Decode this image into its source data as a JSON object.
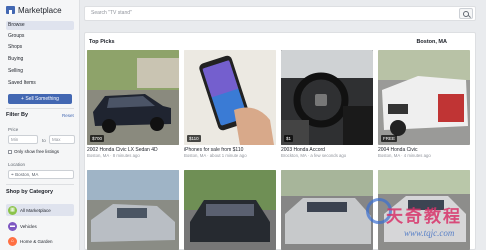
{
  "sidebar": {
    "brand_title": "Marketplace",
    "nav": [
      "Browse",
      "Groups",
      "Shops",
      "Buying",
      "Selling",
      "Saved Items"
    ],
    "sell_button": "+ Sell Something",
    "filter_heading": "Filter By",
    "reset_link": "Reset",
    "price_label": "Price",
    "price_min_placeholder": "Min",
    "price_to": "to",
    "price_max_placeholder": "Max",
    "free_only": "Only show free listings",
    "location_label": "Location",
    "location_value": "Boston, MA",
    "category_heading": "Shop by Category",
    "categories": [
      {
        "label": "All Marketplace",
        "icon": "store-icon",
        "color": "#8bc34a"
      },
      {
        "label": "Vehicles",
        "icon": "car-icon",
        "color": "#7e57c2"
      },
      {
        "label": "Home & Garden",
        "icon": "home-icon",
        "color": "#ff7043"
      }
    ]
  },
  "search": {
    "placeholder": "Search \"TV stand\""
  },
  "panel": {
    "title": "Top Picks",
    "location": "Boston, MA"
  },
  "cards": [
    {
      "price": "$700",
      "title": "2002 Honda Civic LX Sedan 4D",
      "sub": "Boston, MA · 8 minutes ago"
    },
    {
      "price": "$110",
      "title": "iPhones for sale from $110",
      "sub": "Boston, MA · about 1 minute ago"
    },
    {
      "price": "$1",
      "title": "2003 Honda Accord",
      "sub": "Brockton, MA · a few seconds ago"
    },
    {
      "price": "FREE",
      "title": "2004 Honda Civic",
      "sub": "Boston, MA · 4 minutes ago"
    },
    {
      "price": "",
      "title": "",
      "sub": ""
    },
    {
      "price": "",
      "title": "",
      "sub": ""
    },
    {
      "price": "",
      "title": "",
      "sub": ""
    },
    {
      "price": "",
      "title": "",
      "sub": ""
    }
  ],
  "watermark": {
    "text": "天奇教程",
    "url": "www.tqjc.com"
  }
}
